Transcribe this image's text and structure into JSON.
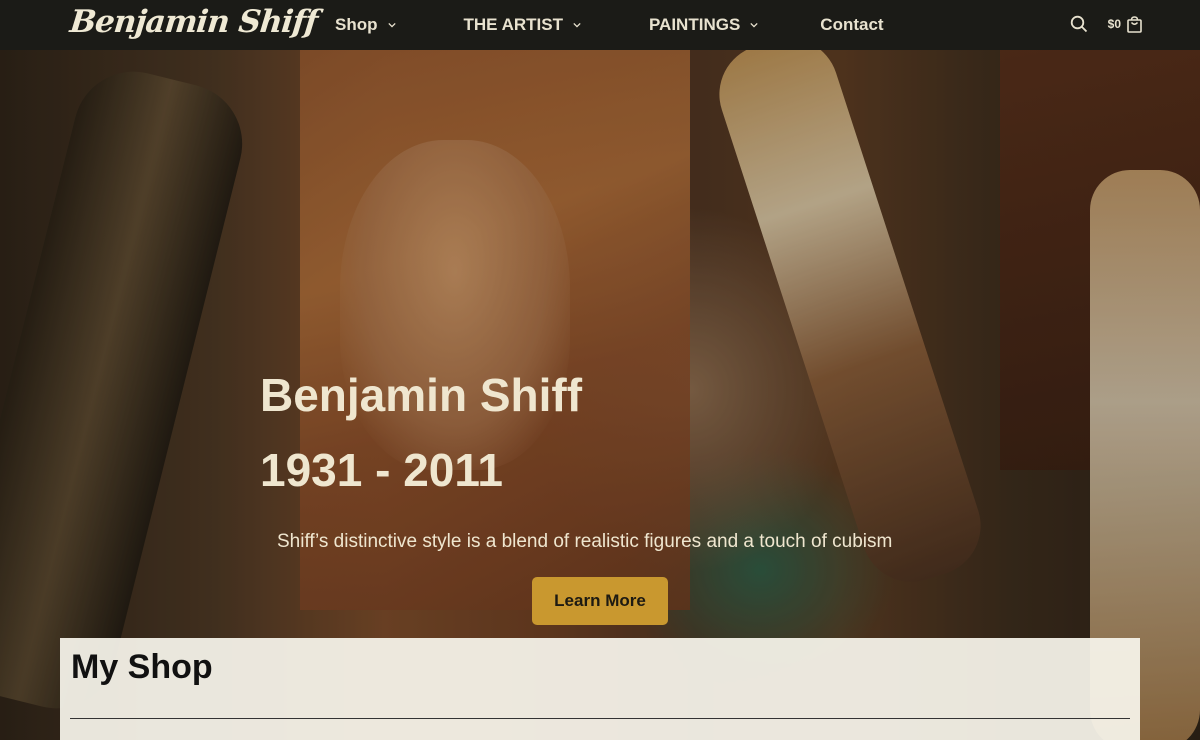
{
  "header": {
    "logo": "Benjamin Shiff",
    "nav": [
      {
        "label": "Shop",
        "has_dropdown": true
      },
      {
        "label": "THE ARTIST",
        "has_dropdown": true
      },
      {
        "label": "PAINTINGS",
        "has_dropdown": true
      },
      {
        "label": "Contact",
        "has_dropdown": false
      }
    ],
    "cart_amount": "$0",
    "icons": [
      "search-icon",
      "cart-bag-icon",
      "chevron-down-icon"
    ]
  },
  "hero": {
    "title": "Benjamin Shiff",
    "years": "1931 - 2011",
    "subtitle": "Shiff’s distinctive style is a blend of realistic figures and a touch of cubism",
    "button_label": "Learn More"
  },
  "shop": {
    "title": "My Shop"
  },
  "colors": {
    "header_bg": "#1b1b17",
    "accent": "#c9982f",
    "text_light": "#efe6cf"
  }
}
